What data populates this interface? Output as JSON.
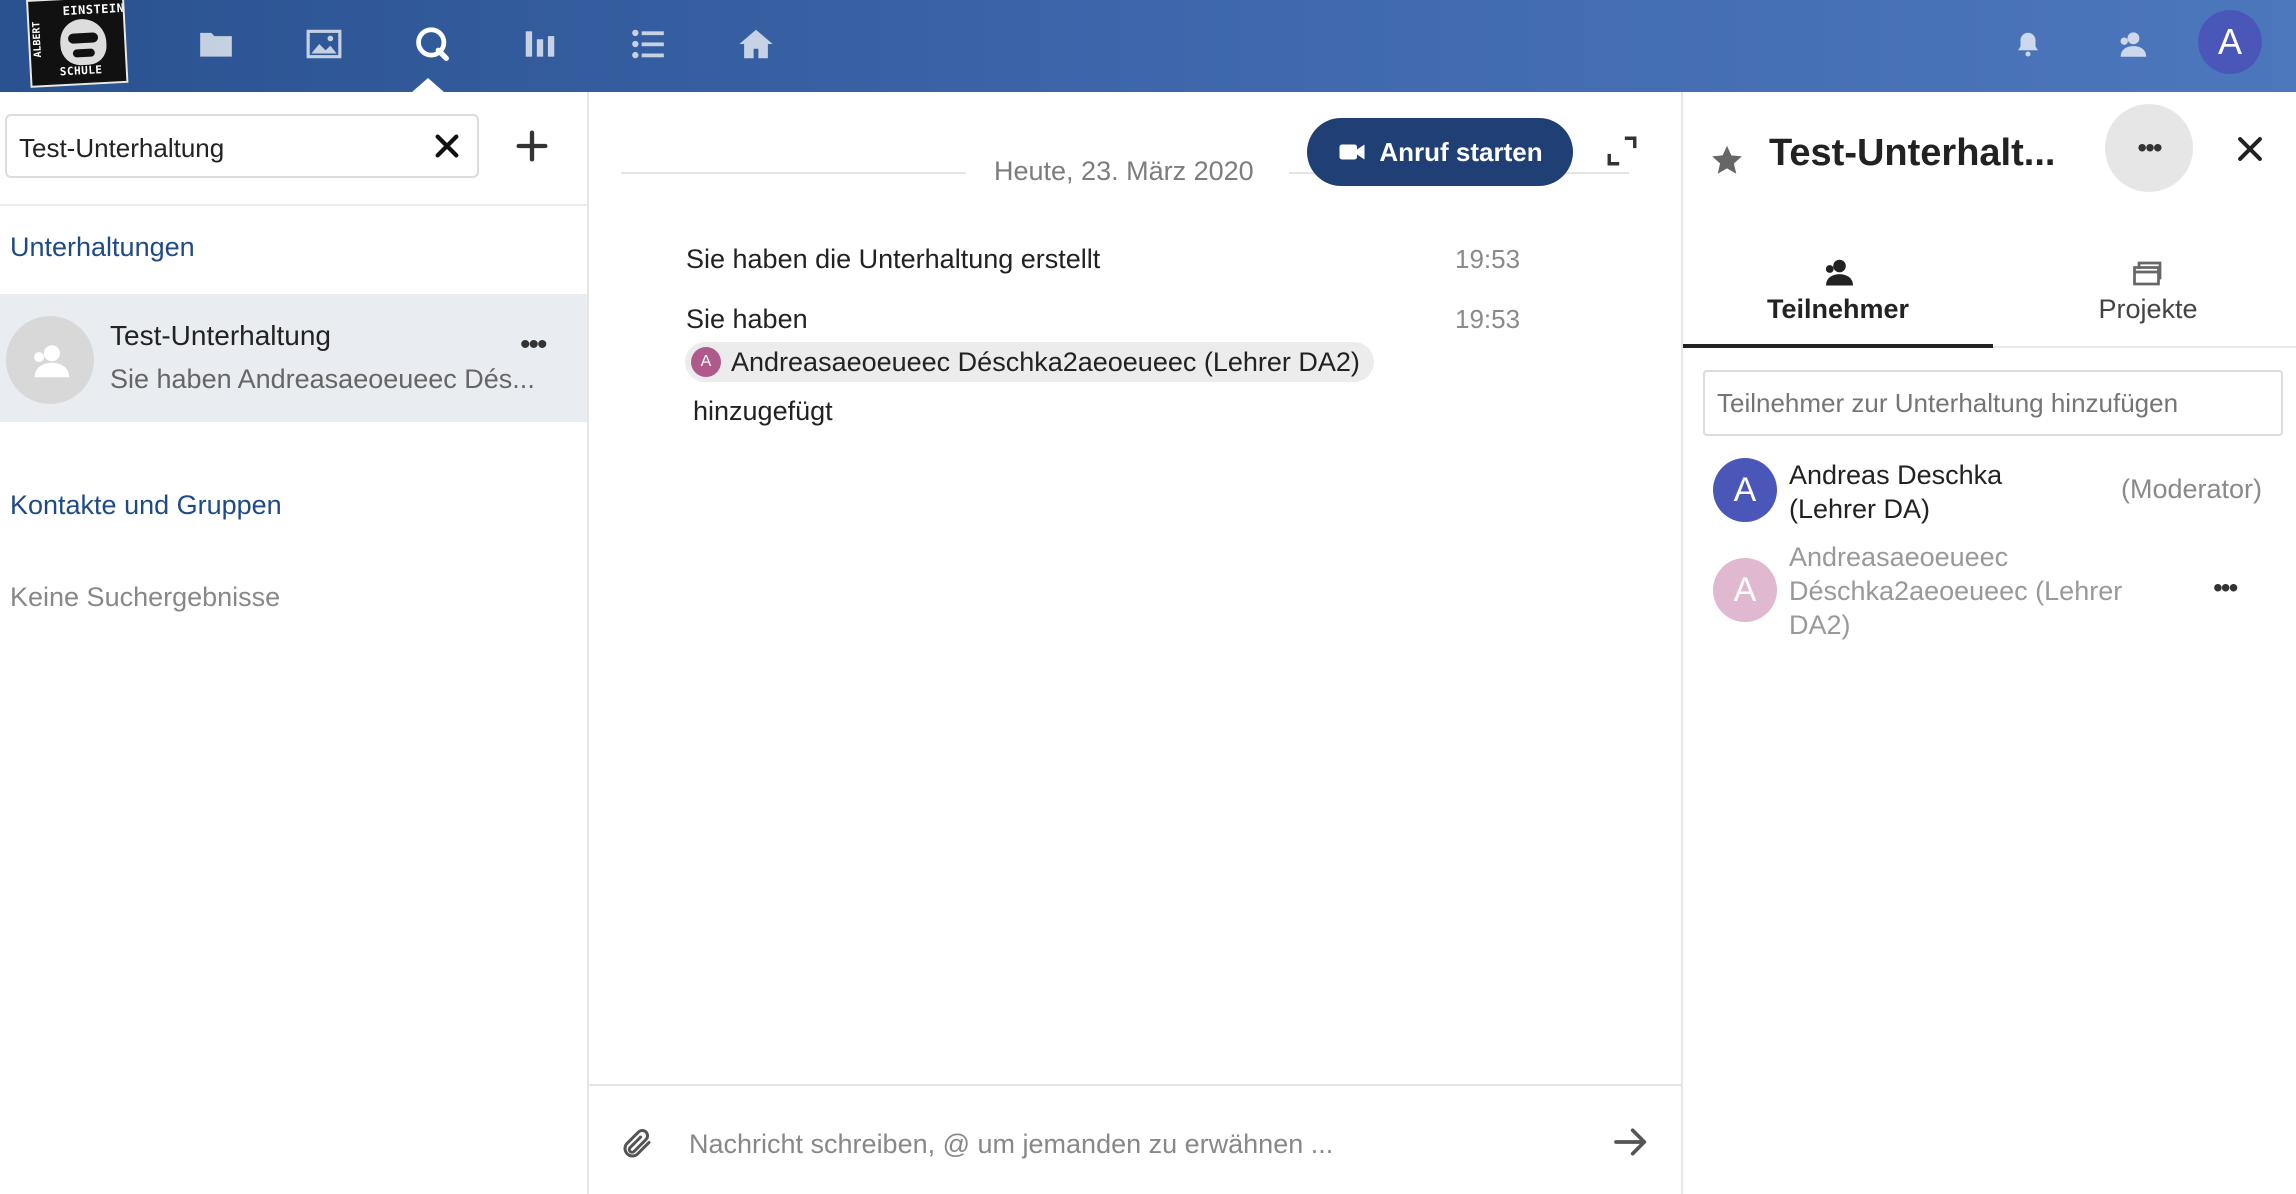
{
  "header": {
    "logo": {
      "top_text": "EINSTEIN",
      "bottom_text": "SCHULE",
      "side_text": "ALBERT"
    },
    "nav": [
      {
        "name": "files",
        "icon": "folder-icon"
      },
      {
        "name": "photos",
        "icon": "image-icon"
      },
      {
        "name": "talk",
        "icon": "search-icon",
        "active": true
      },
      {
        "name": "activity",
        "icon": "bar-chart-icon"
      },
      {
        "name": "tasks",
        "icon": "list-icon"
      },
      {
        "name": "home",
        "icon": "home-icon"
      }
    ],
    "user_avatar_letter": "A",
    "colors": {
      "header_start": "#2a5290",
      "header_end": "#4d77bd",
      "avatar": "#4b57b8"
    }
  },
  "left": {
    "search_value": "Test-Unterhaltung",
    "conversations_title": "Unterhaltungen",
    "conversation": {
      "title": "Test-Unterhaltung",
      "subtitle": "Sie haben Andreasaeoeueec Dés...",
      "menu": "•••"
    },
    "contacts_title": "Kontakte und Gruppen",
    "no_results": "Keine Suchergebnisse",
    "colors": {
      "section_title": "#1e4a86",
      "selected_bg": "#e9ecf1"
    }
  },
  "chat": {
    "date": "Heute, 23. März 2020",
    "call_button": "Anruf starten",
    "messages": [
      {
        "text": "Sie haben die Unterhaltung erstellt",
        "time": "19:53"
      },
      {
        "text_before": "Sie haben",
        "mention": "Andreasaeoeueec Déschka2aeoeueec (Lehrer DA2)",
        "mention_avatar_letter": "A",
        "text_after": "hinzugefügt",
        "time": "19:53"
      }
    ],
    "composer_placeholder": "Nachricht schreiben, @ um jemanden zu erwähnen ...",
    "colors": {
      "call_button": "#1f3f75",
      "mention_avatar": "#b05a8c"
    }
  },
  "right": {
    "title": "Test-Unterhalt...",
    "menu": "•••",
    "tabs": [
      {
        "label": "Teilnehmer",
        "icon": "participants-icon",
        "active": true
      },
      {
        "label": "Projekte",
        "icon": "projects-icon",
        "active": false
      }
    ],
    "add_participant_placeholder": "Teilnehmer zur Unterhaltung hinzufügen",
    "participants": [
      {
        "letter": "A",
        "name": "Andreas Deschka (Lehrer DA)",
        "role": "(Moderator)",
        "color": "#4b57b8",
        "name_color": "#222222"
      },
      {
        "letter": "A",
        "name": "Andreasaeoeueec Déschka2aeoeueec (Lehrer DA2)",
        "menu": "•••",
        "color": "#e0b8cf",
        "name_color": "#999999"
      }
    ]
  }
}
